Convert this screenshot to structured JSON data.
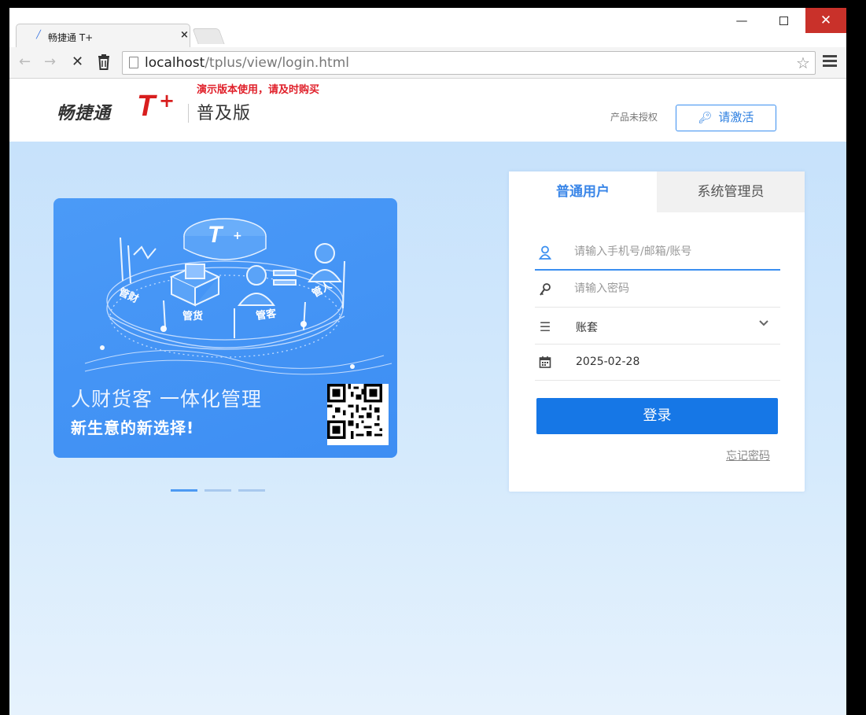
{
  "browser": {
    "tab_title": "畅捷通 T+",
    "url_host": "localhost",
    "url_path": "/tplus/view/login.html"
  },
  "header": {
    "logo_text": "畅捷通",
    "logo_mark": "T",
    "logo_plus": "+",
    "edition": "普及版",
    "demo_notice": "演示版本使用，请及时购买",
    "unlicensed": "产品未授权",
    "activate_label": "请激活"
  },
  "banner": {
    "title": "人财货客 一体化管理",
    "subtitle": "新生意的新选择!",
    "graphic_labels": [
      "管财",
      "管货",
      "管客",
      "管人"
    ],
    "graphic_logo": "T",
    "slides": 3,
    "active_slide": 1
  },
  "login": {
    "tabs": [
      "普通用户",
      "系统管理员"
    ],
    "active_tab": "普通用户",
    "username_placeholder": "请输入手机号/邮箱/账号",
    "password_placeholder": "请输入密码",
    "account_set": "账套",
    "date": "2025-02-28",
    "submit_label": "登录",
    "forgot_label": "忘记密码"
  },
  "colors": {
    "accent": "#1677e6",
    "brand_red": "#d81e1e",
    "banner_blue": "#4196f5"
  }
}
